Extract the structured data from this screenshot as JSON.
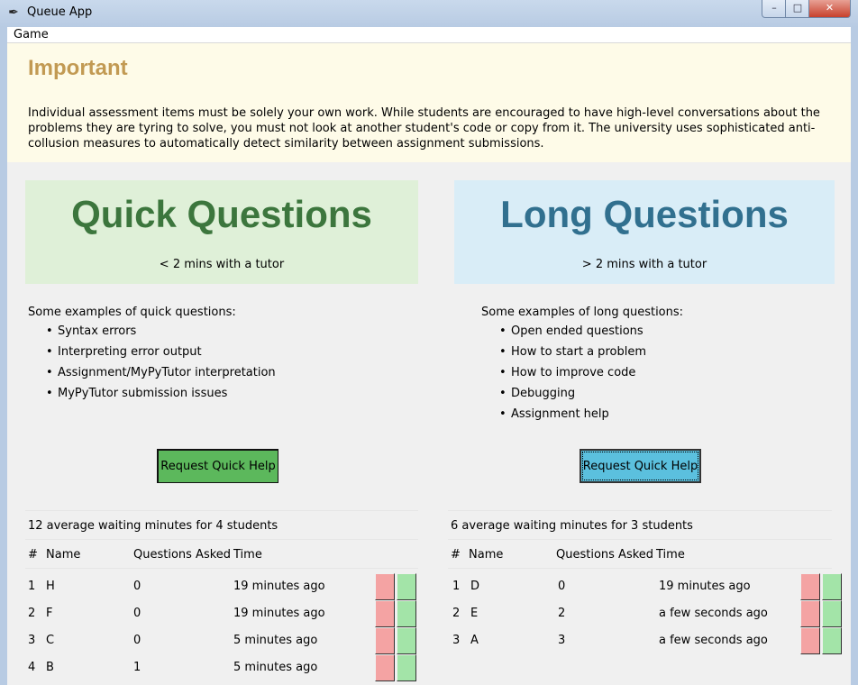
{
  "window": {
    "title": "Queue App",
    "icon": "feather-icon",
    "minimize": "–",
    "maximize": "□",
    "close": "✕"
  },
  "menu": {
    "game": "Game"
  },
  "important": {
    "title": "Important",
    "text": "Individual assessment items must be solely your own work. While students are encouraged to have high-level conversations about the problems they are tyring to solve, you must not look at another student's code or copy from it. The university uses sophisticated anti-collusion measures to automatically detect similarity between assignment submissions."
  },
  "quick": {
    "title": "Quick Questions",
    "subtitle": "< 2 mins with a tutor",
    "examples_heading": "Some examples of quick questions:",
    "examples": [
      "Syntax errors",
      "Interpreting error output",
      "Assignment/MyPyTutor interpretation",
      "MyPyTutor submission issues"
    ],
    "button": "Request Quick Help",
    "wait_summary": "12 average waiting minutes for 4 students",
    "columns": [
      "#",
      "Name",
      "Questions Asked",
      "Time"
    ],
    "rows": [
      {
        "num": "1",
        "name": "H",
        "asked": "0",
        "time": "19 minutes ago"
      },
      {
        "num": "2",
        "name": "F",
        "asked": "0",
        "time": "19 minutes ago"
      },
      {
        "num": "3",
        "name": "C",
        "asked": "0",
        "time": "5 minutes ago"
      },
      {
        "num": "4",
        "name": "B",
        "asked": "1",
        "time": "5 minutes ago"
      }
    ]
  },
  "long": {
    "title": "Long Questions",
    "subtitle": "> 2 mins with a tutor",
    "examples_heading": "Some examples of long questions:",
    "examples": [
      "Open ended questions",
      "How to start a problem",
      "How to improve code",
      "Debugging",
      "Assignment help"
    ],
    "button": "Request Quick Help",
    "wait_summary": "6 average waiting minutes for 3 students",
    "columns": [
      "#",
      "Name",
      "Questions Asked",
      "Time"
    ],
    "rows": [
      {
        "num": "1",
        "name": "D",
        "asked": "0",
        "time": "19 minutes ago"
      },
      {
        "num": "2",
        "name": "E",
        "asked": "2",
        "time": "a few seconds ago"
      },
      {
        "num": "3",
        "name": "A",
        "asked": "3",
        "time": "a few seconds ago"
      }
    ]
  },
  "colors": {
    "important_bg": "#fefbe8",
    "important_title": "#c29a53",
    "quick_bg": "#dff0d8",
    "quick_title": "#3c763d",
    "quick_button": "#5cb85c",
    "long_bg": "#d9edf7",
    "long_title": "#31708f",
    "long_button": "#5bc0de",
    "remove_button": "#f4a3a3",
    "accept_button": "#a3e4a8"
  }
}
